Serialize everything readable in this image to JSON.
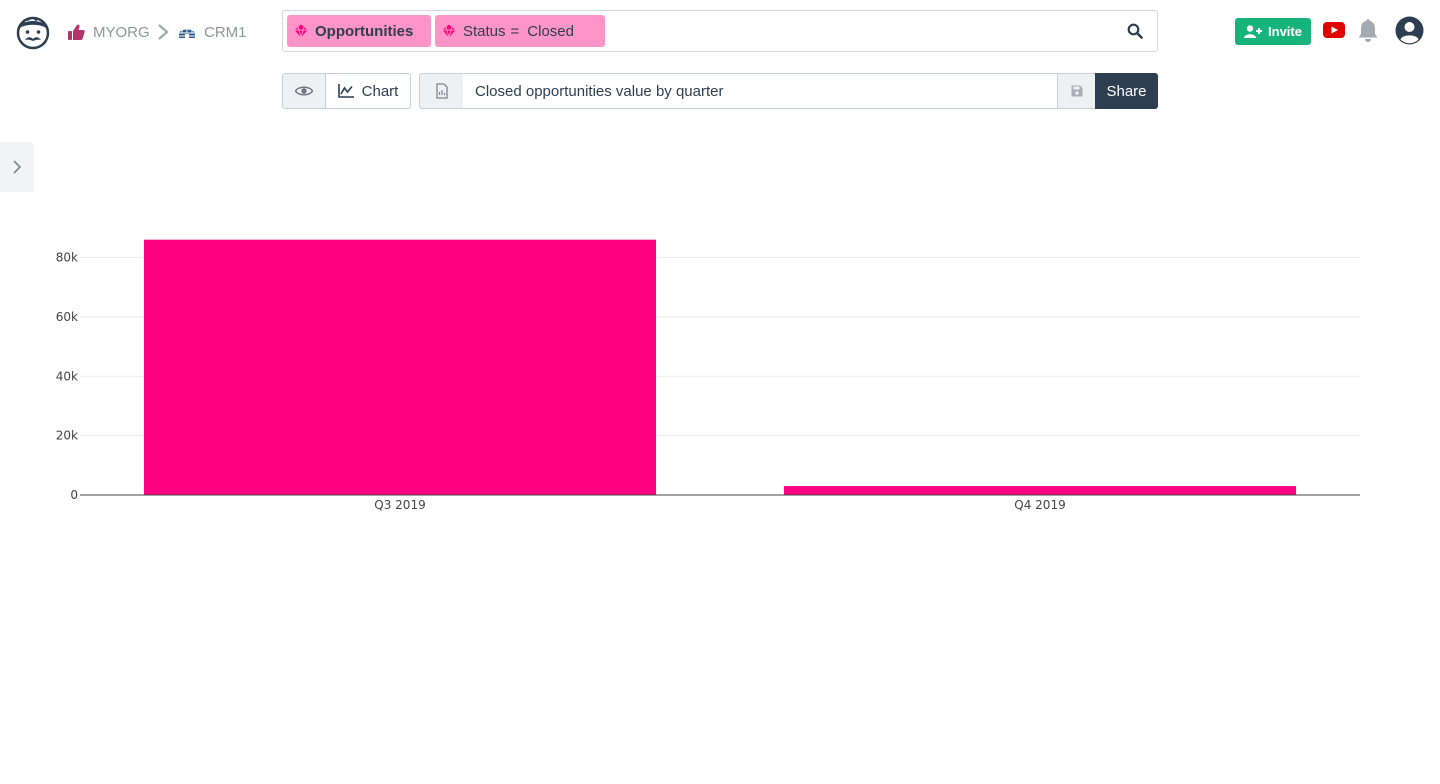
{
  "breadcrumb": {
    "org": "MYORG",
    "database": "CRM1"
  },
  "icons": {
    "logo": "mustache-face-logo-icon",
    "org": "thumbs-up-icon",
    "separator": "chevron-right-icon",
    "database": "igloo-icon",
    "table_chip": "gem-icon",
    "filter_chip": "gem-icon",
    "search": "search-icon",
    "invite": "user-plus-icon",
    "youtube": "youtube-icon",
    "notifications": "bell-icon",
    "account": "user-circle-icon",
    "view": "eye-icon",
    "chart": "line-chart-icon",
    "document": "document-chart-icon",
    "save": "save-icon",
    "sidebar": "chevron-right-icon"
  },
  "search": {
    "table_chip": "Opportunities",
    "filter_field": "Status",
    "filter_op": "=",
    "filter_value": "Closed"
  },
  "header": {
    "invite_label": "Invite"
  },
  "toolbar": {
    "chart_label": "Chart",
    "title_value": "Closed opportunities value by quarter",
    "share_label": "Share"
  },
  "colors": {
    "accent": "#ff0080",
    "chip": "#ff94c8",
    "invite": "#16b47a",
    "share": "#2c3e50",
    "youtube": "#e00000"
  },
  "chart_data": {
    "type": "bar",
    "categories": [
      "Q3 2019",
      "Q4 2019"
    ],
    "values": [
      86000,
      3000
    ],
    "y_ticks": [
      0,
      20000,
      40000,
      60000,
      80000
    ],
    "y_tick_labels": [
      "0",
      "20k",
      "40k",
      "60k",
      "80k"
    ],
    "ylim": [
      0,
      90000
    ],
    "color": "#ff0080",
    "grid": true,
    "title": "",
    "xlabel": "",
    "ylabel": ""
  }
}
